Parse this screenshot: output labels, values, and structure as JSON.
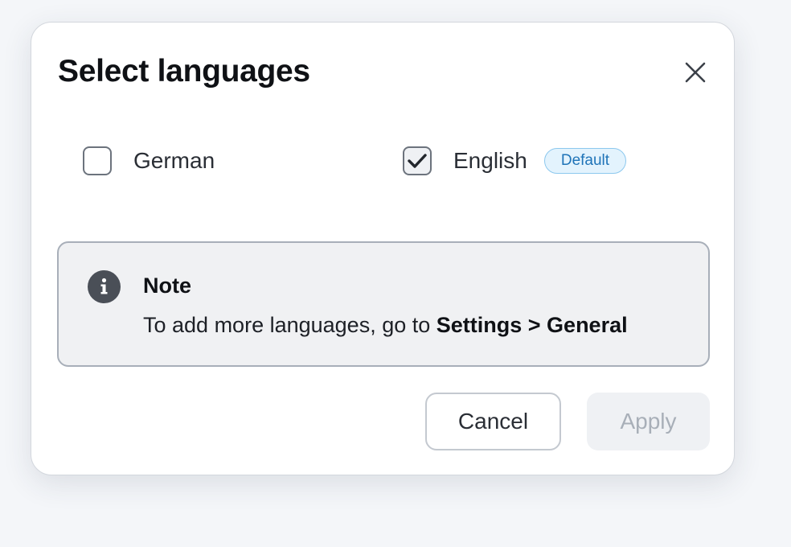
{
  "dialog": {
    "title": "Select languages",
    "close_icon": "close-icon"
  },
  "languages": [
    {
      "label": "German",
      "checked": false
    },
    {
      "label": "English",
      "checked": true,
      "badge": "Default"
    }
  ],
  "note": {
    "icon": "info-icon",
    "title": "Note",
    "text_prefix": "To add more languages, go to ",
    "text_link": "Settings > General"
  },
  "actions": {
    "cancel_label": "Cancel",
    "apply_label": "Apply",
    "apply_disabled": true
  },
  "colors": {
    "badge_background": "#e3f3fd",
    "badge_border": "#8cc8ee",
    "badge_text": "#1f74b8",
    "note_background": "#f0f1f3",
    "disabled_text": "#a8afb8"
  }
}
